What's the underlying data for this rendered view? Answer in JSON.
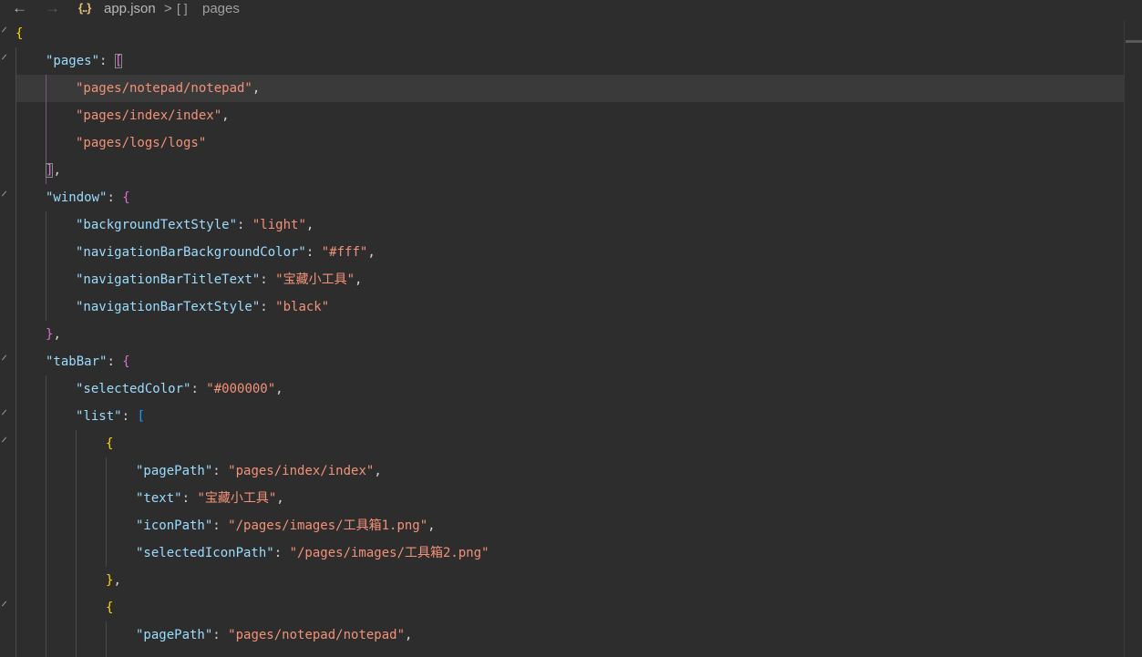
{
  "breadcrumb": {
    "back_icon": "arrow-left-icon",
    "forward_icon": "arrow-right-icon",
    "json_icon": "{..}",
    "file": "app.json",
    "separator": ">",
    "array_icon": "[ ]",
    "node": "pages"
  },
  "lines": [
    [
      "{"
    ],
    [
      "\"pages\"",
      ": ",
      "["
    ],
    [
      "\"pages/notepad/notepad\"",
      ","
    ],
    [
      "\"pages/index/index\"",
      ","
    ],
    [
      "\"pages/logs/logs\""
    ],
    [
      "]",
      ","
    ],
    [
      "\"window\"",
      ": ",
      "{"
    ],
    [
      "\"backgroundTextStyle\"",
      ": ",
      "\"light\"",
      ","
    ],
    [
      "\"navigationBarBackgroundColor\"",
      ": ",
      "\"#fff\"",
      ","
    ],
    [
      "\"navigationBarTitleText\"",
      ": ",
      "\"宝藏小工具\"",
      ","
    ],
    [
      "\"navigationBarTextStyle\"",
      ": ",
      "\"black\""
    ],
    [
      "}",
      ","
    ],
    [
      "\"tabBar\"",
      ": ",
      "{"
    ],
    [
      "\"selectedColor\"",
      ": ",
      "\"#000000\"",
      ","
    ],
    [
      "\"list\"",
      ": ",
      "["
    ],
    [
      "{"
    ],
    [
      "\"pagePath\"",
      ": ",
      "\"pages/index/index\"",
      ","
    ],
    [
      "\"text\"",
      ": ",
      "\"宝藏小工具\"",
      ","
    ],
    [
      "\"iconPath\"",
      ": ",
      "\"/pages/images/工具箱1.png\"",
      ","
    ],
    [
      "\"selectedIconPath\"",
      ": ",
      "\"/pages/images/工具箱2.png\""
    ],
    [
      "}",
      ","
    ],
    [
      "{"
    ],
    [
      "\"pagePath\"",
      ": ",
      "\"pages/notepad/notepad\"",
      ","
    ]
  ],
  "colors": {
    "background": "#2d2d2d",
    "key": "#9cdcfe",
    "string": "#f29278",
    "bracket_level1": "#ffd700",
    "bracket_level2": "#da70d6",
    "bracket_level3": "#179fff"
  }
}
